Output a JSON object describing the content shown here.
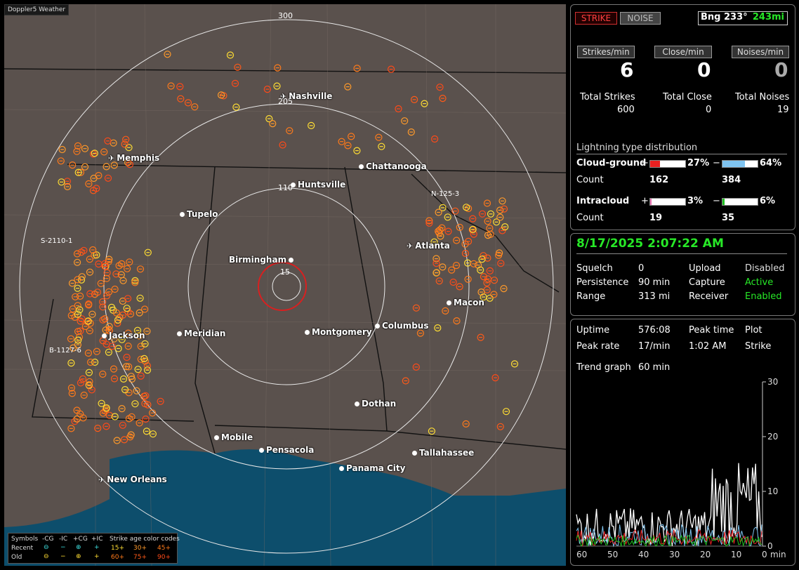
{
  "app": {
    "brand": "Doppler5 Weather"
  },
  "map": {
    "ring_labels": [
      "300",
      "205",
      "110",
      "15"
    ],
    "tags": [
      "N-125-3",
      "S-2110-1",
      "B-1127-6"
    ],
    "cities": [
      {
        "name": "Nashville",
        "plane": true
      },
      {
        "name": "Memphis",
        "plane": true
      },
      {
        "name": "Chattanooga",
        "plane": false
      },
      {
        "name": "Huntsville",
        "plane": false
      },
      {
        "name": "Tupelo",
        "plane": false
      },
      {
        "name": "Atlanta",
        "plane": true
      },
      {
        "name": "Birmingham",
        "plane": false
      },
      {
        "name": "Macon",
        "plane": false
      },
      {
        "name": "Jackson",
        "plane": false
      },
      {
        "name": "Meridian",
        "plane": false
      },
      {
        "name": "Montgomery",
        "plane": false
      },
      {
        "name": "Columbus",
        "plane": false
      },
      {
        "name": "Dothan",
        "plane": false
      },
      {
        "name": "Mobile",
        "plane": false
      },
      {
        "name": "Pensacola",
        "plane": false
      },
      {
        "name": "Tallahassee",
        "plane": false
      },
      {
        "name": "Panama City",
        "plane": false
      },
      {
        "name": "New Orleans",
        "plane": true
      }
    ],
    "legend": {
      "symbols": "Symbols",
      "headers": [
        "-CG",
        "-IC",
        "+CG",
        "+IC"
      ],
      "age_title": "Strike age color codes",
      "recent": "Recent",
      "old": "Old",
      "recent_ages": [
        "15+",
        "30+",
        "45+"
      ],
      "old_ages": [
        "60+",
        "75+",
        "90+"
      ],
      "age_colors": [
        "#ffdd33",
        "#ff9a2a",
        "#ff7a1a",
        "#ff7a1a",
        "#ff5a18",
        "#ff4a18"
      ]
    }
  },
  "panel1": {
    "strike_btn": "STRIKE",
    "noise_btn": "NOISE",
    "bearing": "Bng 233°",
    "distance": "243mi",
    "rate_buttons": [
      "Strikes/min",
      "Close/min",
      "Noises/min"
    ],
    "rates": [
      "6",
      "0",
      "0"
    ],
    "totals_labels": [
      "Total Strikes",
      "Total Close",
      "Total Noises"
    ],
    "totals_values": [
      "600",
      "0",
      "19"
    ],
    "dist_title": "Lightning type distribution",
    "cloud_ground": "Cloud-ground",
    "intracloud": "Intracloud",
    "count": "Count",
    "plus": "+",
    "minus": "−",
    "cg_plus_pct": "27%",
    "cg_minus_pct": "64%",
    "cg_plus_count": "162",
    "cg_minus_count": "384",
    "ic_plus_pct": "3%",
    "ic_minus_pct": "6%",
    "ic_plus_count": "19",
    "ic_minus_count": "35",
    "fills": {
      "cg_plus": 0.27,
      "cg_minus": 0.64,
      "ic_plus": 0.03,
      "ic_minus": 0.06
    },
    "colors": {
      "cg_plus": "#e82020",
      "cg_minus": "#7fc4f0",
      "ic_plus": "#e870b0",
      "ic_minus": "#20c020"
    }
  },
  "panel2": {
    "datetime": "8/17/2025 2:07:22 AM",
    "rows": [
      [
        "Squelch",
        "0",
        "Upload",
        "Disabled"
      ],
      [
        "Persistence",
        "90 min",
        "Capture",
        "Active"
      ],
      [
        "Range",
        "313 mi",
        "Receiver",
        "Enabled"
      ]
    ]
  },
  "panel3": {
    "uptime_label": "Uptime",
    "uptime": "576:08",
    "peak_time_label": "Peak time",
    "plot_label": "Plot",
    "peak_rate_label": "Peak rate",
    "peak_rate": "17/min",
    "peak_time": "1:02 AM",
    "plot": "Strike",
    "trend_label": "Trend graph",
    "trend_value": "60 min",
    "y_ticks": [
      "30",
      "20",
      "10",
      "0"
    ],
    "x_ticks": [
      "60",
      "50",
      "40",
      "30",
      "20",
      "10",
      "0"
    ],
    "x_unit": "min"
  }
}
